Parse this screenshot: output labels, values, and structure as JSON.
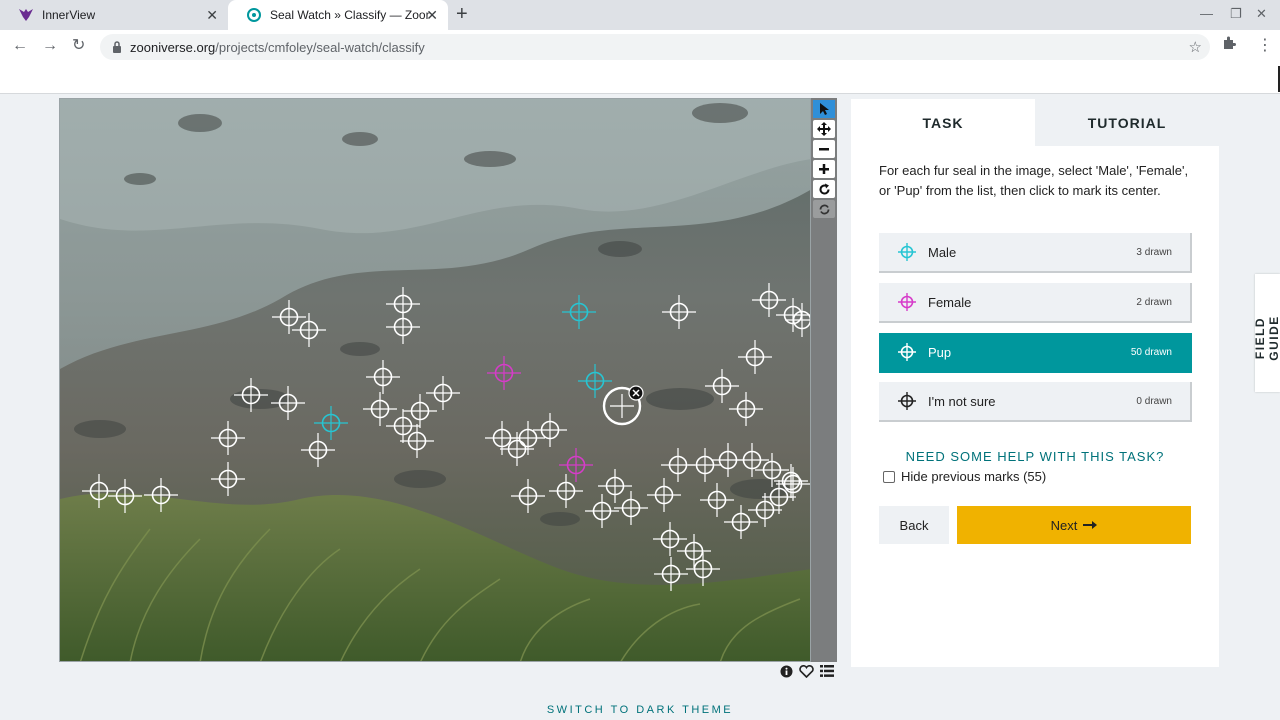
{
  "browser": {
    "tabs": [
      {
        "title": "InnerView",
        "active": false
      },
      {
        "title": "Seal Watch » Classify — Zooniverse",
        "active": true
      }
    ],
    "url_host": "zooniverse.org",
    "url_path": "/projects/cmfoley/seal-watch/classify"
  },
  "task_panel": {
    "tabs": [
      "TASK",
      "TUTORIAL"
    ],
    "instructions": "For each fur seal in the image, select 'Male', 'Female', or 'Pup' from the list, then click to mark its center.",
    "choices": [
      {
        "label": "Male",
        "count": "3 drawn",
        "color": "#27c5d3"
      },
      {
        "label": "Female",
        "count": "2 drawn",
        "color": "#d63cc9"
      },
      {
        "label": "Pup",
        "count": "50 drawn",
        "color": "#ffffff",
        "selected": true
      },
      {
        "label": "I'm not sure",
        "count": "0 drawn",
        "color": "#222222"
      }
    ],
    "help_link": "NEED SOME HELP WITH THIS TASK?",
    "hide_marks": "Hide previous marks (55)",
    "back_label": "Back",
    "next_label": "Next"
  },
  "field_guide": "FIELD GUIDE",
  "dark_theme": "SWITCH TO DARK THEME",
  "colors": {
    "teal": "#00979d",
    "next": "#f0b200",
    "male": "#27c5d3",
    "female": "#d63cc9",
    "pup": "#ffffff"
  },
  "icons": [
    "pointer-icon",
    "move-icon",
    "zoom-out-icon",
    "zoom-in-icon",
    "rotate-icon",
    "reset-icon",
    "info-icon",
    "heart-icon",
    "list-icon"
  ]
}
